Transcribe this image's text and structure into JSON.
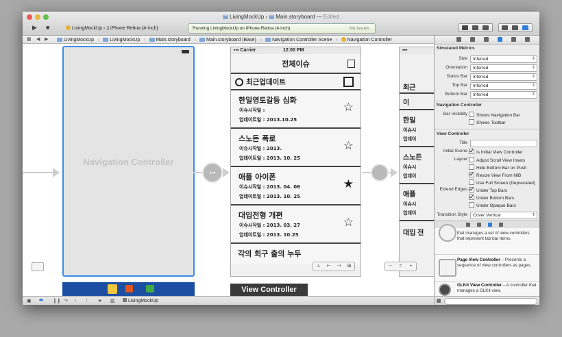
{
  "window": {
    "title_project": "LivingMockUp",
    "title_sep": "›",
    "title_file": "Main.storyboard",
    "title_status": "Edited"
  },
  "toolbar": {
    "scheme": "LivingMockUp",
    "destination": "iPhone Retina (4-inch)",
    "activity_text": "Running LivingMockUp on iPhone Retina (4-inch)",
    "issues": "No Issues"
  },
  "jumpbar": {
    "crumbs": [
      "LivingMockUp",
      "LivingMockUp",
      "Main.storyboard",
      "Main.storyboard (Base)",
      "Navigation Controller Scene",
      "Navigation Controller"
    ]
  },
  "canvas": {
    "nav_controller_label": "Navigation Controller",
    "view_controller_label": "View Controller",
    "status_carrier": "Carrier",
    "status_time": "12:00 PM",
    "mock_title": "전체이슈",
    "update_label": "최근업데이트",
    "cells": [
      {
        "title": "한일영토갈등 심화",
        "line1": "이슈시작일 :",
        "line2": "업데이트일 : 2013.10.25",
        "starred": false
      },
      {
        "title": "스노든 폭로",
        "line1": "이슈시작일 : 2013.",
        "line2": "업데이트일 : 2013. 10. 25",
        "starred": false
      },
      {
        "title": "애플 아이폰",
        "line1": "이슈시작일 : 2013. 04. 06",
        "line2": "업데이트일 : 2013. 10. 25",
        "starred": true
      },
      {
        "title": "대입전형 개편",
        "line1": "이슈시작일 : 2013. 03. 27",
        "line2": "업데이트일 : 2013. 10.25",
        "starred": false
      }
    ],
    "last_cell": "각의 회구 출의 누두",
    "phone2_rows": [
      "최근",
      "이",
      "한일",
      "이슈시",
      "업데이",
      "스노든",
      "이슈시",
      "업데이",
      "애플",
      "이슈시",
      "업데이",
      "대입 전"
    ]
  },
  "bottombar": {
    "scheme": "LivingMockUp"
  },
  "inspector": {
    "simulated_metrics": "Simulated Metrics",
    "metrics": [
      {
        "label": "Size",
        "value": "Inferred"
      },
      {
        "label": "Orientation",
        "value": "Inferred"
      },
      {
        "label": "Status Bar",
        "value": "Inferred"
      },
      {
        "label": "Top Bar",
        "value": "Inferred"
      },
      {
        "label": "Bottom Bar",
        "value": "Inferred"
      }
    ],
    "nav_controller_section": "Navigation Controller",
    "bar_visibility_label": "Bar Visibility",
    "shows_nav_bar": "Shows Navigation Bar",
    "shows_toolbar": "Shows Toolbar",
    "view_controller_section": "View Controller",
    "title_label": "Title",
    "initial_scene_label": "Initial Scene",
    "is_initial": "Is Initial View Controller",
    "layout_label": "Layout",
    "adjust_scroll": "Adjust Scroll View Insets",
    "hide_bottom_bar": "Hide Bottom Bar on Push",
    "resize_from_nib": "Resize View From NIB",
    "full_screen": "Use Full Screen (Deprecated)",
    "extend_edges_label": "Extend Edges",
    "under_top": "Under Top Bars",
    "under_bottom": "Under Bottom Bars",
    "under_opaque": "Under Opaque Bars",
    "transition_label": "Transition Style",
    "transition_value": "Cover Vertical",
    "library": [
      {
        "name": "",
        "desc": "that manages a set of view controllers that represent tab bar items."
      },
      {
        "name": "Page View Controller",
        "desc": " – Presents a sequence of view controllers as pages."
      },
      {
        "name": "GLKit View Controller",
        "desc": " – A controller that manages a GLKit view."
      }
    ]
  }
}
